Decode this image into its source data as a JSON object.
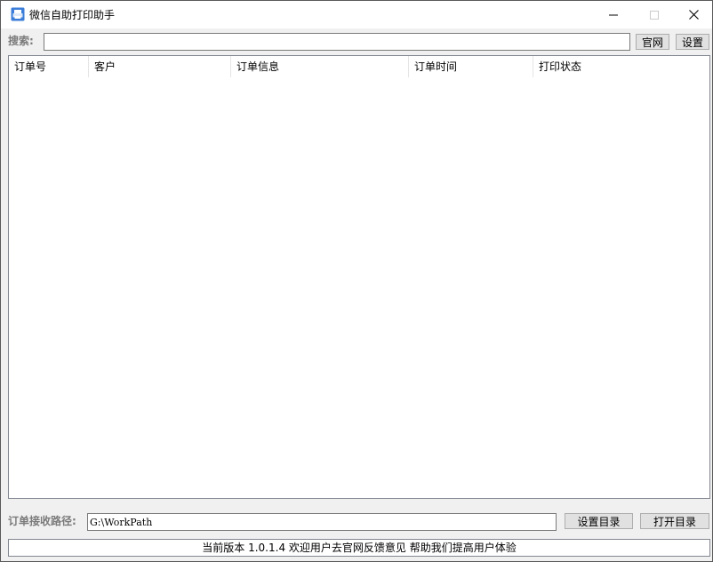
{
  "window": {
    "title": "微信自助打印助手",
    "icon": "printer-icon",
    "controls": {
      "minimize": "─",
      "maximize": "☐",
      "close": "✕"
    }
  },
  "search": {
    "label": "搜索:",
    "value": "",
    "official_site_button": "官网",
    "settings_button": "设置"
  },
  "order_table": {
    "columns": [
      "订单号",
      "客户",
      "订单信息",
      "订单时间",
      "打印状态"
    ],
    "rows": []
  },
  "path": {
    "label": "订单接收路径:",
    "value": "G:\\WorkPath",
    "set_dir_button": "设置目录",
    "open_dir_button": "打开目录"
  },
  "status": {
    "text": "当前版本 1.0.1.4 欢迎用户去官网反馈意见 帮助我们提高用户体验"
  },
  "colors": {
    "window_bg": "#f0f0f0",
    "titlebar_bg": "#ffffff",
    "button_bg": "#e1e1e1",
    "label_gray": "#7a7a7a",
    "icon_blue": "#3b7dd8"
  }
}
